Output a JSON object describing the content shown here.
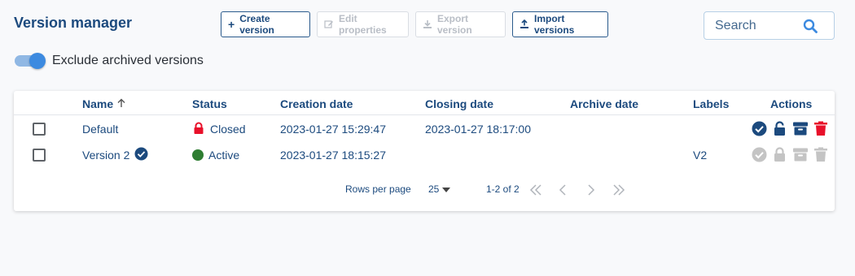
{
  "header": {
    "title": "Version manager"
  },
  "toolbar": {
    "create_label": "Create version",
    "edit_label": "Edit properties",
    "export_label": "Export version",
    "import_label": "Import versions"
  },
  "search": {
    "placeholder": "Search"
  },
  "filter": {
    "exclude_archived_label": "Exclude archived versions",
    "exclude_archived_on": true
  },
  "table": {
    "columns": {
      "name": "Name",
      "status": "Status",
      "creation_date": "Creation date",
      "closing_date": "Closing date",
      "archive_date": "Archive date",
      "labels": "Labels",
      "actions": "Actions"
    },
    "rows": [
      {
        "name": "Default",
        "status": "Closed",
        "creation_date": "2023-01-27 15:29:47",
        "closing_date": "2023-01-27 18:17:00",
        "archive_date": "",
        "labels": ""
      },
      {
        "name": "Version 2",
        "status": "Active",
        "creation_date": "2023-01-27 18:15:27",
        "closing_date": "",
        "archive_date": "",
        "labels": "V2"
      }
    ]
  },
  "pagination": {
    "rows_per_page_label": "Rows per page",
    "rows_per_page_value": "25",
    "range": "1-2 of 2"
  },
  "colors": {
    "primary": "#1c4a7e",
    "closed_lock": "#e8102a",
    "active_dot": "#2e7d32",
    "delete": "#e8102a",
    "disabled": "#bdbdbd"
  }
}
